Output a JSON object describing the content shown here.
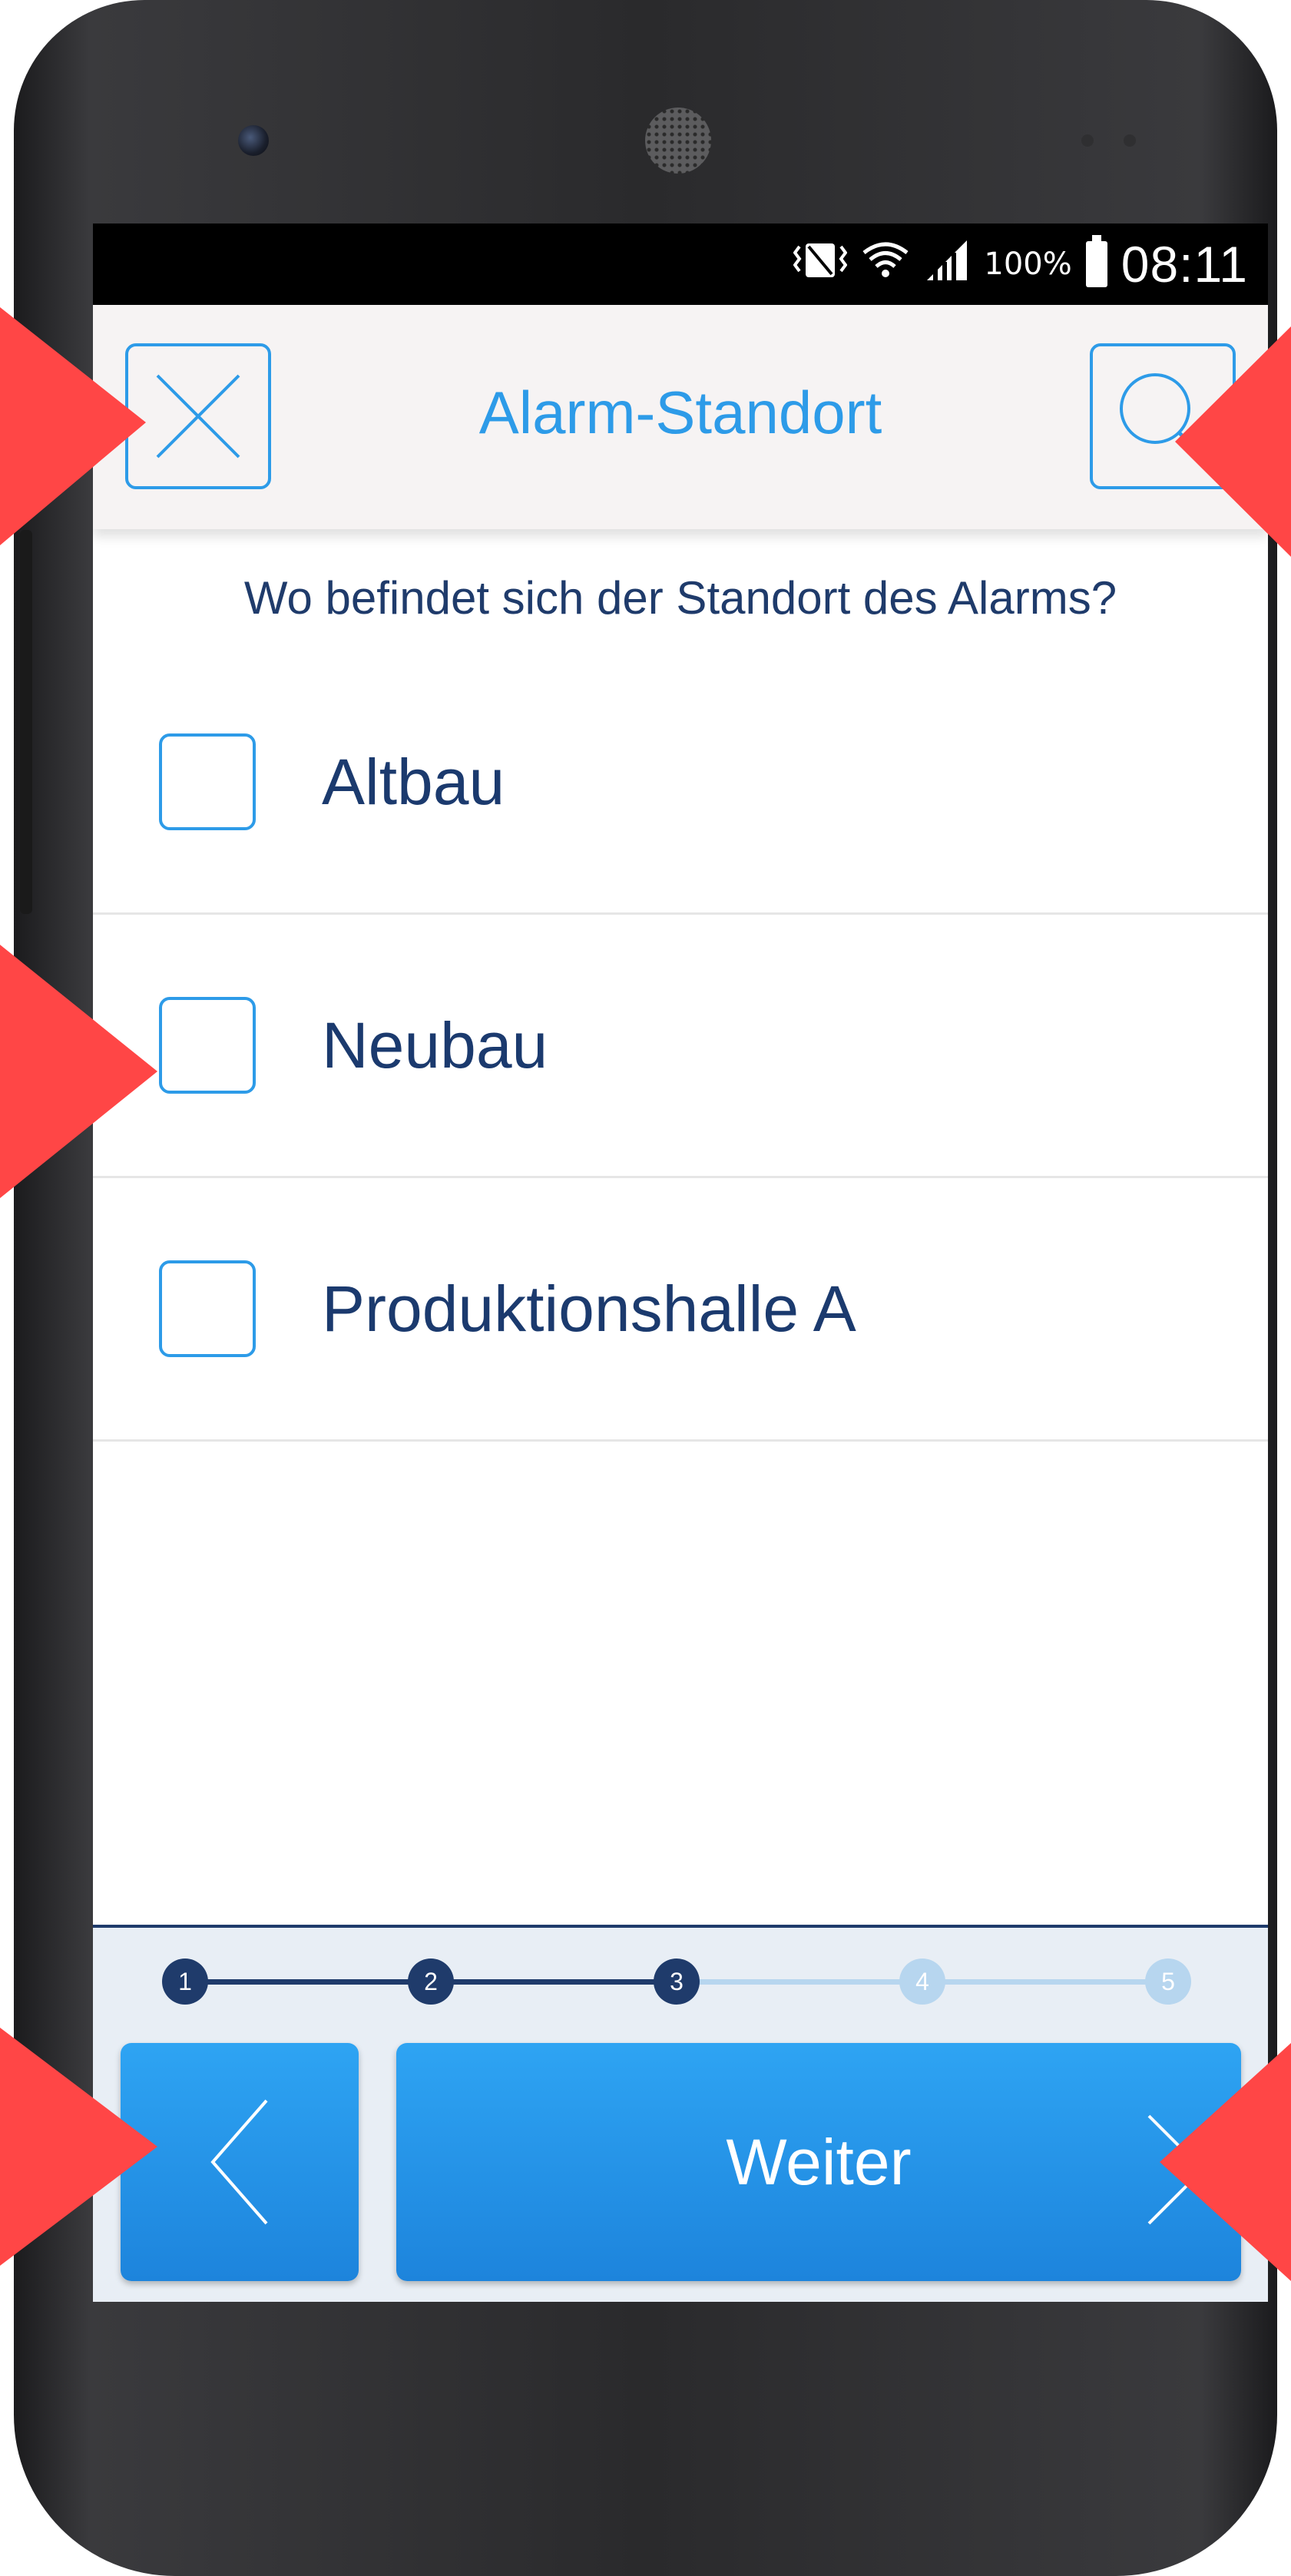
{
  "status_bar": {
    "battery_percent": "100%",
    "time": "08:11",
    "icons": [
      "vibrate-icon",
      "wifi-icon",
      "signal-icon",
      "battery-icon"
    ]
  },
  "header": {
    "title": "Alarm-Standort",
    "close_icon": "close-icon",
    "search_icon": "search-icon"
  },
  "question": "Wo befindet sich der Standort des Alarms?",
  "options": [
    {
      "label": "Altbau",
      "checked": false
    },
    {
      "label": "Neubau",
      "checked": false
    },
    {
      "label": "Produktionshalle A",
      "checked": false
    }
  ],
  "progress": {
    "steps": [
      "1",
      "2",
      "3",
      "4",
      "5"
    ],
    "current": 3
  },
  "navigation": {
    "back_icon": "chevron-left-icon",
    "next_label": "Weiter",
    "next_icon": "chevron-right-icon"
  },
  "colors": {
    "accent": "#2d9be8",
    "dark_blue": "#1f3b6b",
    "light_blue": "#b7d6ef",
    "annotation_arrow": "#ff4646",
    "header_bg": "#f6f3f3"
  }
}
